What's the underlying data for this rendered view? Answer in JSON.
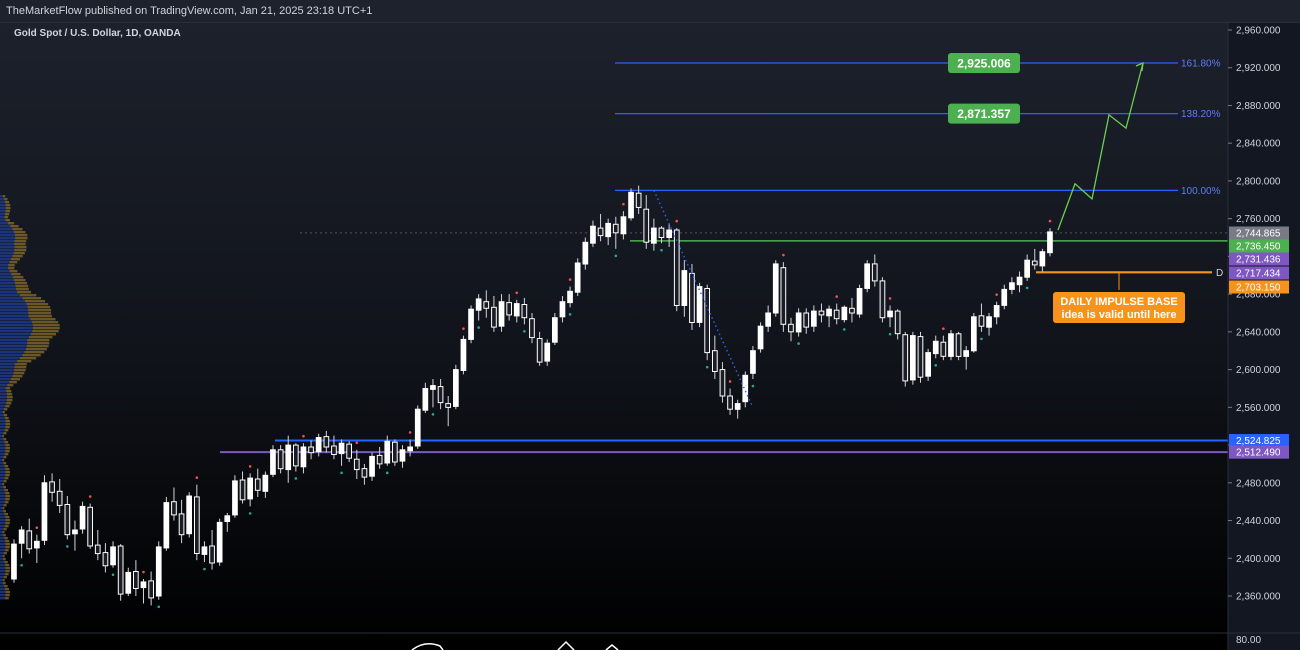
{
  "header": {
    "published": "TheMarketFlow published on TradingView.com, Jan 21, 2025 23:18 UTC+1",
    "symbol": "Gold Spot / U.S. Dollar, 1D, OANDA"
  },
  "colors": {
    "up": "#ffffff",
    "down": "#ffffff",
    "fib": "#2962ff",
    "green": "#4caf50",
    "purple": "#7e57c2",
    "orange": "#f7931a",
    "axis_text": "#d1d4dc"
  },
  "chart_data": {
    "type": "candlestick",
    "ylim": [
      2330,
      2970
    ],
    "y_ticks": [
      "2,960.000",
      "2,920.000",
      "2,880.000",
      "2,840.000",
      "2,800.000",
      "2,760.000",
      "2,720.000",
      "2,680.000",
      "2,640.000",
      "2,600.000",
      "2,560.000",
      "2,520.000",
      "2,480.000",
      "2,440.000",
      "2,400.000",
      "2,360.000"
    ],
    "y_tick_values": [
      2960,
      2920,
      2880,
      2840,
      2800,
      2760,
      2720,
      2680,
      2640,
      2600,
      2560,
      2520,
      2480,
      2440,
      2400,
      2360
    ],
    "volume_axis_label": "80.00",
    "ohlc": [
      [
        2378,
        2420,
        2374,
        2415
      ],
      [
        2416,
        2434,
        2400,
        2430
      ],
      [
        2429,
        2442,
        2405,
        2410
      ],
      [
        2411,
        2425,
        2395,
        2418
      ],
      [
        2419,
        2488,
        2414,
        2480
      ],
      [
        2481,
        2490,
        2460,
        2470
      ],
      [
        2471,
        2484,
        2448,
        2456
      ],
      [
        2457,
        2466,
        2420,
        2425
      ],
      [
        2426,
        2440,
        2408,
        2430
      ],
      [
        2431,
        2460,
        2426,
        2455
      ],
      [
        2454,
        2458,
        2410,
        2413
      ],
      [
        2414,
        2430,
        2398,
        2405
      ],
      [
        2406,
        2416,
        2385,
        2392
      ],
      [
        2393,
        2418,
        2390,
        2412
      ],
      [
        2413,
        2415,
        2355,
        2362
      ],
      [
        2363,
        2390,
        2360,
        2385
      ],
      [
        2386,
        2398,
        2360,
        2368
      ],
      [
        2369,
        2378,
        2352,
        2375
      ],
      [
        2376,
        2386,
        2350,
        2358
      ],
      [
        2360,
        2418,
        2356,
        2412
      ],
      [
        2411,
        2465,
        2408,
        2459
      ],
      [
        2460,
        2475,
        2440,
        2446
      ],
      [
        2447,
        2462,
        2416,
        2425
      ],
      [
        2426,
        2470,
        2422,
        2466
      ],
      [
        2465,
        2478,
        2398,
        2405
      ],
      [
        2404,
        2418,
        2396,
        2412
      ],
      [
        2413,
        2430,
        2388,
        2395
      ],
      [
        2396,
        2442,
        2392,
        2438
      ],
      [
        2439,
        2448,
        2428,
        2445
      ],
      [
        2446,
        2488,
        2443,
        2482
      ],
      [
        2483,
        2492,
        2458,
        2462
      ],
      [
        2463,
        2490,
        2455,
        2485
      ],
      [
        2484,
        2495,
        2465,
        2472
      ],
      [
        2471,
        2492,
        2464,
        2488
      ],
      [
        2489,
        2520,
        2486,
        2515
      ],
      [
        2515,
        2520,
        2490,
        2495
      ],
      [
        2494,
        2530,
        2480,
        2520
      ],
      [
        2520,
        2522,
        2492,
        2498
      ],
      [
        2497,
        2522,
        2490,
        2518
      ],
      [
        2518,
        2525,
        2505,
        2512
      ],
      [
        2513,
        2532,
        2508,
        2528
      ],
      [
        2529,
        2535,
        2512,
        2518
      ],
      [
        2519,
        2530,
        2505,
        2510
      ],
      [
        2511,
        2526,
        2498,
        2522
      ],
      [
        2521,
        2524,
        2502,
        2506
      ],
      [
        2505,
        2515,
        2484,
        2494
      ],
      [
        2495,
        2500,
        2478,
        2486
      ],
      [
        2487,
        2512,
        2482,
        2508
      ],
      [
        2509,
        2518,
        2495,
        2500
      ],
      [
        2501,
        2530,
        2498,
        2524
      ],
      [
        2523,
        2526,
        2498,
        2502
      ],
      [
        2503,
        2520,
        2496,
        2515
      ],
      [
        2514,
        2526,
        2508,
        2518
      ],
      [
        2519,
        2562,
        2516,
        2558
      ],
      [
        2557,
        2586,
        2554,
        2580
      ],
      [
        2579,
        2590,
        2560,
        2583
      ],
      [
        2582,
        2590,
        2558,
        2565
      ],
      [
        2564,
        2572,
        2540,
        2560
      ],
      [
        2561,
        2605,
        2558,
        2600
      ],
      [
        2599,
        2636,
        2595,
        2632
      ],
      [
        2632,
        2668,
        2628,
        2664
      ],
      [
        2663,
        2680,
        2652,
        2675
      ],
      [
        2672,
        2684,
        2655,
        2665
      ],
      [
        2666,
        2678,
        2640,
        2645
      ],
      [
        2646,
        2680,
        2640,
        2672
      ],
      [
        2671,
        2680,
        2652,
        2658
      ],
      [
        2657,
        2674,
        2650,
        2670
      ],
      [
        2669,
        2676,
        2648,
        2655
      ],
      [
        2654,
        2660,
        2628,
        2634
      ],
      [
        2633,
        2640,
        2604,
        2608
      ],
      [
        2609,
        2632,
        2604,
        2628
      ],
      [
        2629,
        2660,
        2626,
        2655
      ],
      [
        2656,
        2678,
        2650,
        2672
      ],
      [
        2671,
        2688,
        2666,
        2683
      ],
      [
        2682,
        2718,
        2678,
        2713
      ],
      [
        2712,
        2740,
        2706,
        2735
      ],
      [
        2734,
        2758,
        2730,
        2752
      ],
      [
        2750,
        2765,
        2736,
        2742
      ],
      [
        2741,
        2760,
        2732,
        2755
      ],
      [
        2754,
        2762,
        2728,
        2745
      ],
      [
        2744,
        2768,
        2738,
        2762
      ],
      [
        2761,
        2792,
        2758,
        2788
      ],
      [
        2787,
        2795,
        2765,
        2772
      ],
      [
        2770,
        2785,
        2728,
        2735
      ],
      [
        2734,
        2760,
        2726,
        2750
      ],
      [
        2750,
        2752,
        2734,
        2740
      ],
      [
        2740,
        2755,
        2730,
        2748
      ],
      [
        2748,
        2750,
        2662,
        2668
      ],
      [
        2668,
        2716,
        2656,
        2705
      ],
      [
        2702,
        2712,
        2642,
        2650
      ],
      [
        2650,
        2692,
        2645,
        2688
      ],
      [
        2686,
        2690,
        2610,
        2618
      ],
      [
        2620,
        2636,
        2590,
        2598
      ],
      [
        2600,
        2608,
        2565,
        2572
      ],
      [
        2572,
        2580,
        2552,
        2558
      ],
      [
        2558,
        2568,
        2548,
        2564
      ],
      [
        2566,
        2598,
        2560,
        2594
      ],
      [
        2596,
        2625,
        2590,
        2620
      ],
      [
        2622,
        2650,
        2618,
        2646
      ],
      [
        2646,
        2668,
        2640,
        2660
      ],
      [
        2660,
        2716,
        2656,
        2712
      ],
      [
        2708,
        2714,
        2640,
        2648
      ],
      [
        2648,
        2655,
        2630,
        2640
      ],
      [
        2640,
        2665,
        2635,
        2660
      ],
      [
        2660,
        2665,
        2638,
        2645
      ],
      [
        2646,
        2668,
        2640,
        2662
      ],
      [
        2662,
        2670,
        2650,
        2658
      ],
      [
        2657,
        2668,
        2645,
        2664
      ],
      [
        2663,
        2670,
        2648,
        2654
      ],
      [
        2653,
        2668,
        2650,
        2666
      ],
      [
        2665,
        2676,
        2650,
        2660
      ],
      [
        2659,
        2690,
        2655,
        2686
      ],
      [
        2686,
        2716,
        2682,
        2712
      ],
      [
        2712,
        2722,
        2688,
        2694
      ],
      [
        2694,
        2698,
        2650,
        2655
      ],
      [
        2656,
        2668,
        2645,
        2662
      ],
      [
        2662,
        2664,
        2632,
        2638
      ],
      [
        2637,
        2640,
        2582,
        2588
      ],
      [
        2589,
        2640,
        2584,
        2636
      ],
      [
        2635,
        2640,
        2586,
        2592
      ],
      [
        2593,
        2622,
        2588,
        2618
      ],
      [
        2617,
        2636,
        2612,
        2630
      ],
      [
        2629,
        2636,
        2610,
        2614
      ],
      [
        2614,
        2642,
        2610,
        2638
      ],
      [
        2638,
        2640,
        2610,
        2614
      ],
      [
        2614,
        2625,
        2600,
        2620
      ],
      [
        2620,
        2660,
        2618,
        2656
      ],
      [
        2657,
        2670,
        2640,
        2646
      ],
      [
        2645,
        2660,
        2636,
        2656
      ],
      [
        2656,
        2672,
        2648,
        2668
      ],
      [
        2668,
        2690,
        2664,
        2685
      ],
      [
        2685,
        2698,
        2680,
        2692
      ],
      [
        2690,
        2704,
        2682,
        2698
      ],
      [
        2698,
        2722,
        2694,
        2716
      ],
      [
        2715,
        2728,
        2706,
        2711
      ],
      [
        2710,
        2728,
        2704,
        2725
      ],
      [
        2724,
        2750,
        2720,
        2746
      ]
    ],
    "levels": [
      {
        "price": 2744.865,
        "label": "2,744.865",
        "color": "#787b86"
      },
      {
        "price": 2736.45,
        "label": "2,736.450",
        "color": "#4caf50"
      },
      {
        "price": 2731.436,
        "label": "2,731.436",
        "color": "#7e57c2"
      },
      {
        "price": 2717.434,
        "label": "2,717.434",
        "color": "#7e57c2"
      },
      {
        "price": 2703.15,
        "label": "2,703.150",
        "color": "#f7931a"
      },
      {
        "price": 2524.825,
        "label": "2,524.825",
        "color": "#2962ff"
      },
      {
        "price": 2512.49,
        "label": "2,512.490",
        "color": "#7e57c2"
      }
    ],
    "fib_levels": [
      {
        "pct": "161.80%",
        "price": 2925.006
      },
      {
        "pct": "138.20%",
        "price": 2871.357
      },
      {
        "pct": "100.00%",
        "price": 2790.0
      }
    ],
    "targets": [
      {
        "label": "2,925.006",
        "price": 2925.006
      },
      {
        "label": "2,871.357",
        "price": 2871.357
      }
    ],
    "projection_path": [
      [
        2748,
        0
      ],
      [
        2797,
        1
      ],
      [
        2781,
        2
      ],
      [
        2870,
        3
      ],
      [
        2856,
        4
      ],
      [
        2925,
        5
      ]
    ],
    "annotation": {
      "line1": "DAILY IMPULSE BASE",
      "line2": "idea is valid until here",
      "marker": "D"
    }
  }
}
